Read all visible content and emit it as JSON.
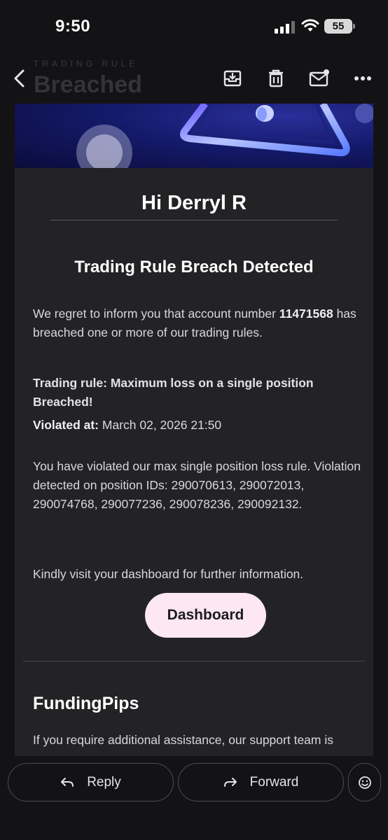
{
  "status_bar": {
    "time": "9:50",
    "battery": "55"
  },
  "ghost": {
    "subtitle": "TRADING RULE",
    "title": "Breached"
  },
  "email": {
    "greeting": "Hi Derryl R",
    "heading": "Trading Rule Breach Detected",
    "intro_prefix": "We regret to inform you that account number ",
    "account_number": "11471568",
    "intro_suffix": " has breached one or more of our trading rules.",
    "rule_line": "Trading rule: Maximum loss on a single position",
    "rule_status": "Breached!",
    "violated_label": "Violated at:",
    "violated_value": " March 02, 2026 21:50",
    "violation_text": "You have violated our max single position loss rule. Violation detected on position IDs: 290070613, 290072013, 290074768, 290077236, 290078236, 290092132.",
    "dashboard_note": "Kindly visit your dashboard for further information.",
    "dashboard_button": "Dashboard",
    "brand": "FundingPips",
    "support_text": "If you require additional assistance, our support team is"
  },
  "actions": {
    "reply_label": "Reply",
    "forward_label": "Forward"
  },
  "colors": {
    "dashboard_button_bg": "#fce7f3",
    "card_bg": "#232326",
    "page_bg": "#131315"
  }
}
